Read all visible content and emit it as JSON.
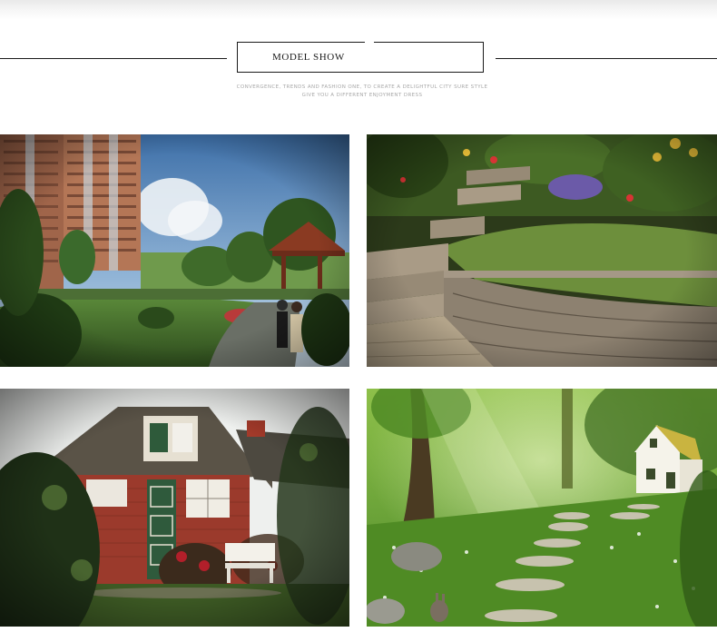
{
  "header": {
    "title": "MODEL SHOW",
    "subtitle_line1": "CONVERGENCE, TRENDS AND FASHION ONE, TO CREATE A DELIGHTFUL CITY SURE STYLE",
    "subtitle_line2": "GIVE YOU A DIFFERENT ENJOYMENT DRESS"
  },
  "colors": {
    "rule": "#1a1a1a",
    "subtitle": "#a8a8a8",
    "background": "#ffffff"
  }
}
